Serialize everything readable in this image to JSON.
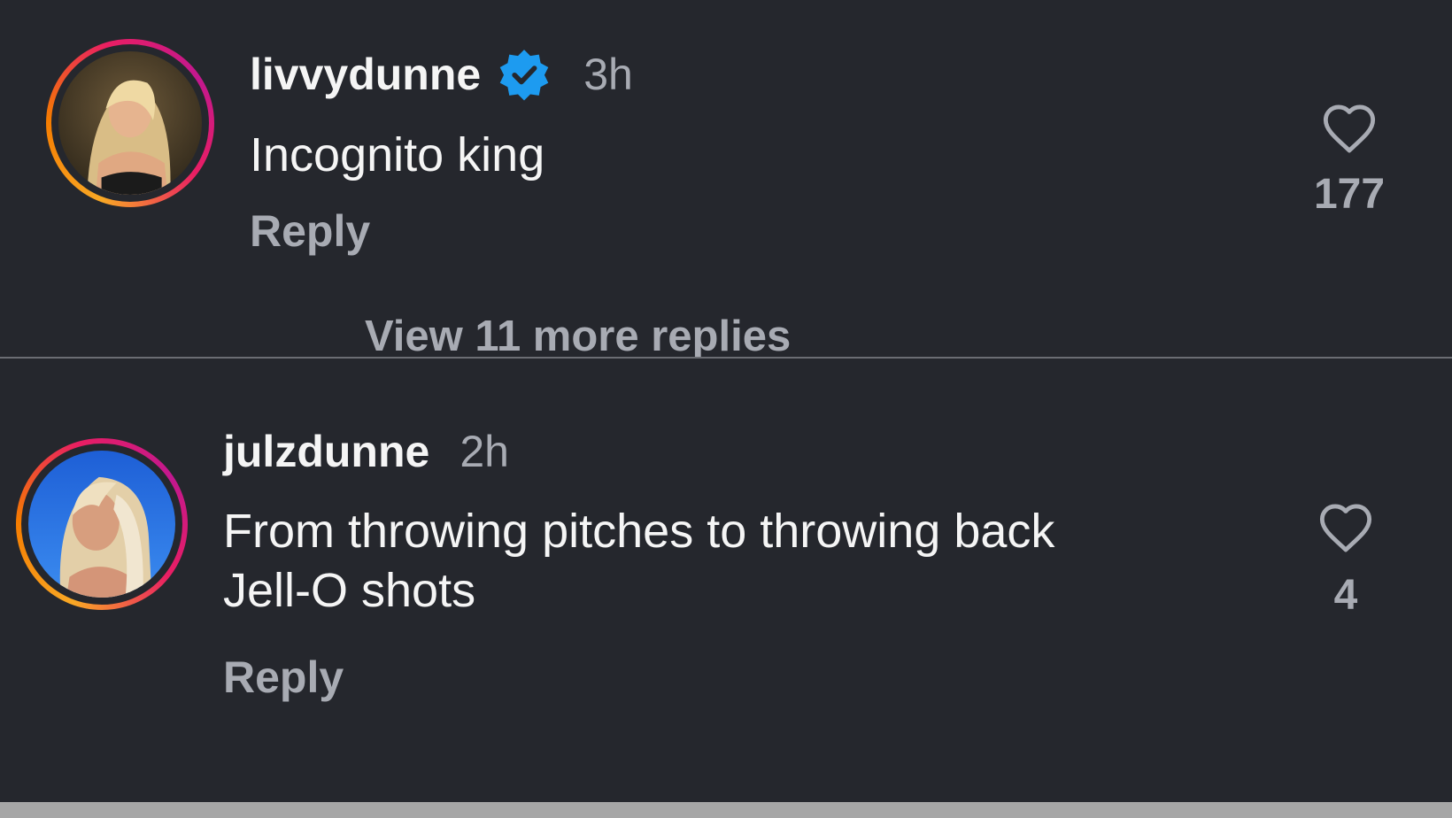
{
  "comments": [
    {
      "username": "livvydunne",
      "verified": true,
      "time": "3h",
      "text": "Incognito king",
      "reply_label": "Reply",
      "likes": "177",
      "view_replies_label": "View 11 more replies",
      "avatar_icon": "profile-photo"
    },
    {
      "username": "julzdunne",
      "verified": false,
      "time": "2h",
      "text_line1": "From throwing pitches to throwing back",
      "text_line2": "Jell-O shots",
      "reply_label": "Reply",
      "likes": "4",
      "avatar_icon": "profile-photo"
    }
  ],
  "colors": {
    "background": "#25272d",
    "primary_text": "#f5f5f5",
    "secondary_text": "#a8abb3",
    "verified_blue": "#1d9bf0",
    "divider": "#6b6d73",
    "footer_strip": "#a6a6a6"
  }
}
